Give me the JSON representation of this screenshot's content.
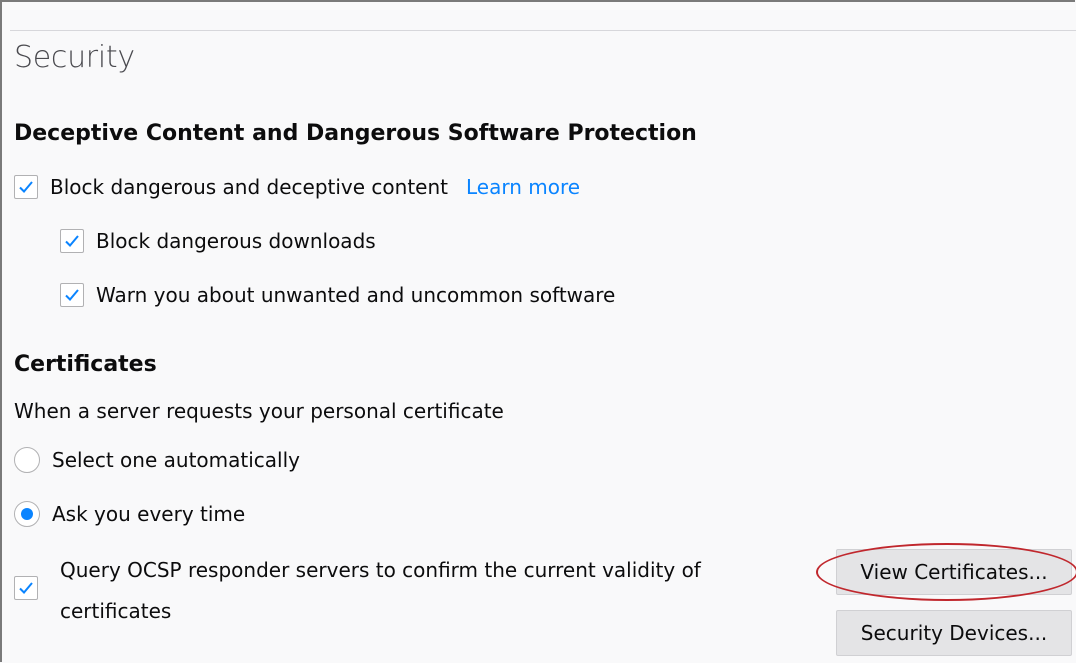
{
  "section": {
    "title": "Security"
  },
  "deceptive": {
    "heading": "Deceptive Content and Dangerous Software Protection",
    "block_content": {
      "label": "Block dangerous and deceptive content",
      "checked": true,
      "learn_more": "Learn more"
    },
    "block_downloads": {
      "label": "Block dangerous downloads",
      "checked": true
    },
    "warn_unwanted": {
      "label": "Warn you about unwanted and uncommon software",
      "checked": true
    }
  },
  "certificates": {
    "heading": "Certificates",
    "description": "When a server requests your personal certificate",
    "radio_auto": {
      "label": "Select one automatically",
      "selected": false
    },
    "radio_ask": {
      "label": "Ask you every time",
      "selected": true
    },
    "ocsp": {
      "line1": "Query OCSP responder servers to confirm the current validity of",
      "line2": "certificates",
      "checked": true
    },
    "view_certificates_button": "View Certificates...",
    "security_devices_button": "Security Devices..."
  },
  "colors": {
    "accent": "#0a84ff",
    "highlight_ring": "#c0272d"
  },
  "icons": {
    "checkbox_checked": "checkmark-icon",
    "radio_selected": "radio-dot-icon"
  }
}
